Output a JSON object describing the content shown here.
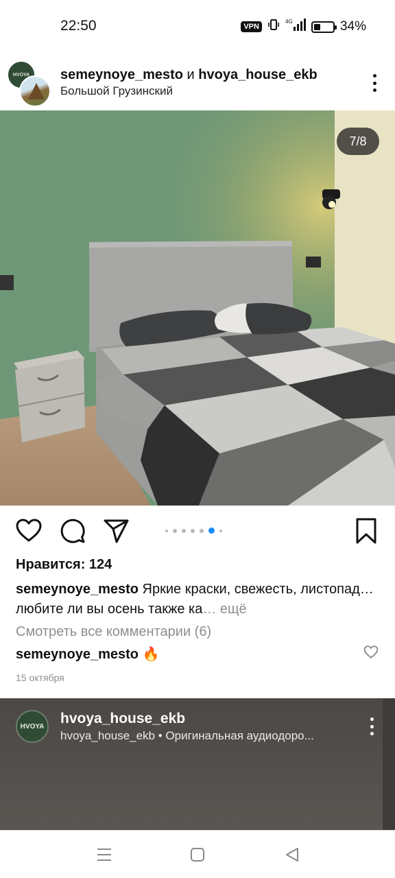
{
  "status_bar": {
    "time": "22:50",
    "vpn": "VPN",
    "network": "4G",
    "battery": "34%",
    "battery_level": 0.34
  },
  "post": {
    "user_primary": "semeynoye_mesto",
    "user_conj": "и",
    "user_secondary": "hvoya_house_ekb",
    "location": "Большой Грузинский",
    "avatar_primary_text": "HVOYA",
    "image_counter": "7/8",
    "carousel_index": 6,
    "carousel_total": 8,
    "likes": "Нравится: 124",
    "caption_user": "semeynoye_mesto",
    "caption_text": "Яркие краски, свежесть, листопад… любите ли вы осень также ка",
    "caption_more": "… ещё",
    "view_comments": "Смотреть все комментарии (6)",
    "comment_user": "semeynoye_mesto",
    "comment_text": "🔥",
    "date": "15 октября"
  },
  "next_post": {
    "avatar_text": "HVOYA",
    "user": "hvoya_house_ekb",
    "subtitle": "hvoya_house_ekb • Оригинальная аудиодоро..."
  },
  "icons": {
    "like": "heart-icon",
    "comment": "comment-icon",
    "share": "send-icon",
    "save": "bookmark-icon",
    "more": "more-vertical-icon"
  },
  "colors": {
    "accent_dot": "#1a8cff",
    "muted_text": "#8e8e8e",
    "wall_green": "#6f9778"
  }
}
